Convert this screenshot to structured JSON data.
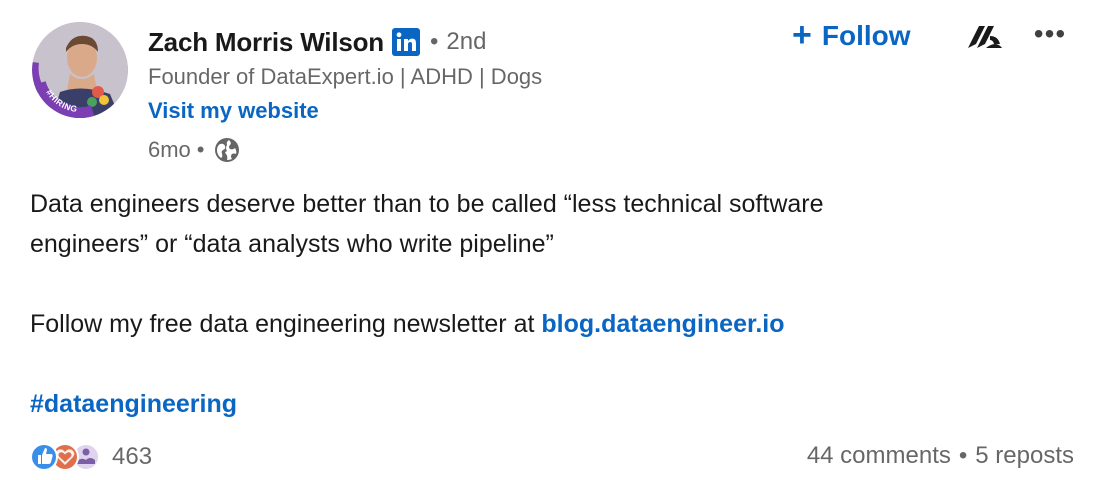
{
  "author": {
    "name": "Zach Morris Wilson",
    "degree": "2nd",
    "headline": "Founder of DataExpert.io | ADHD | Dogs",
    "website_label": "Visit my website",
    "avatar_badge": "#HIRING",
    "verified_icon": "linkedin-in-icon"
  },
  "post": {
    "age": "6mo",
    "visibility_icon": "globe-icon",
    "text_line1": "Data engineers deserve better than to be called “less technical software",
    "text_line2": "engineers” or “data analysts who write pipeline”",
    "newsletter_prefix": "Follow my free data engineering newsletter at ",
    "newsletter_link": "blog.dataengineer.io",
    "hashtag": "#dataengineering"
  },
  "actions": {
    "follow_label": "Follow",
    "follow_icon": "plus-icon",
    "more_label": "•••",
    "brand_icon": "stacked-a-logo-icon"
  },
  "social": {
    "reaction_count": "463",
    "reaction_icons": [
      "like-icon",
      "love-icon",
      "support-icon"
    ],
    "comments": "44 comments",
    "reposts": "5 reposts"
  },
  "colors": {
    "link_blue": "#0a66c2",
    "secondary_text": "#666666",
    "primary_text": "#191919",
    "linkedin_blue": "#0a66c2",
    "hiring_purple": "#7b3fb3"
  }
}
